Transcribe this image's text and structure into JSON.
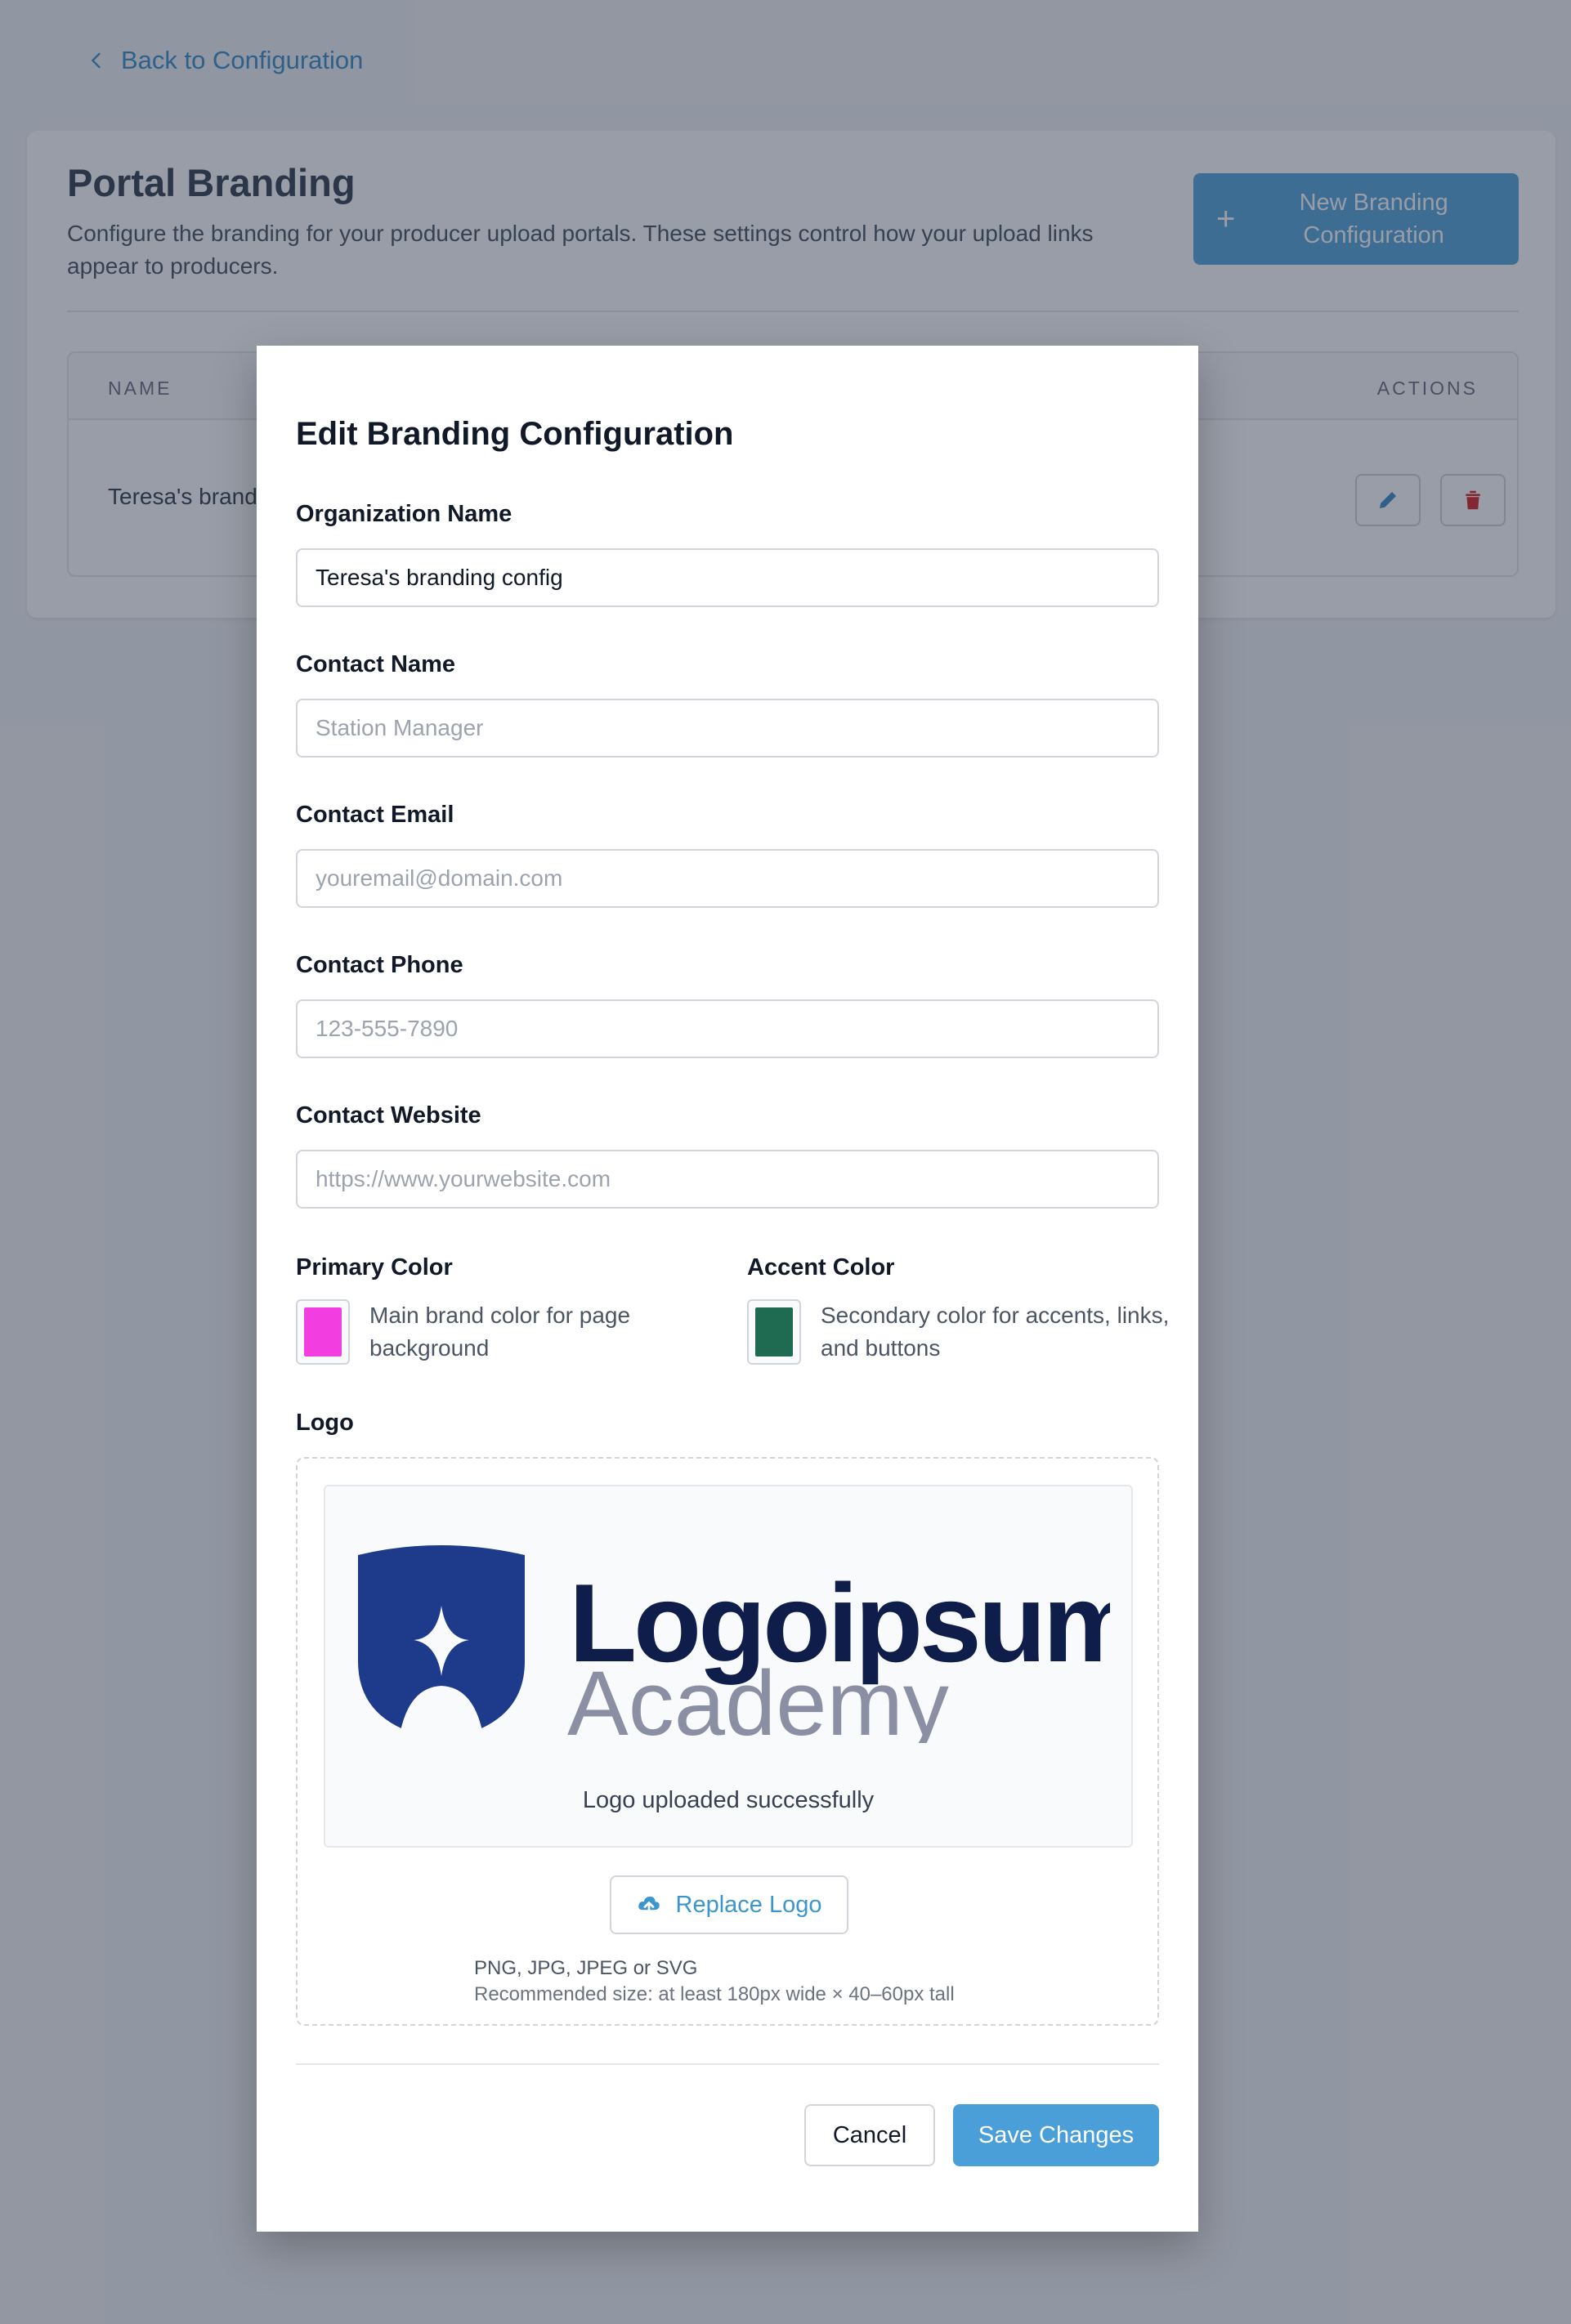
{
  "background": {
    "back_link": "Back to Configuration",
    "title": "Portal Branding",
    "description": "Configure the branding for your producer upload portals. These settings control how your upload links appear to producers.",
    "new_button": "New Branding Configuration",
    "table": {
      "headers": {
        "name": "NAME",
        "actions": "ACTIONS"
      },
      "rows": [
        {
          "name": "Teresa's branding config"
        }
      ]
    }
  },
  "modal": {
    "title": "Edit Branding Configuration",
    "fields": {
      "org_name": {
        "label": "Organization Name",
        "value": "Teresa's branding config",
        "placeholder": ""
      },
      "contact_name": {
        "label": "Contact Name",
        "value": "",
        "placeholder": "Station Manager"
      },
      "contact_email": {
        "label": "Contact Email",
        "value": "",
        "placeholder": "youremail@domain.com"
      },
      "contact_phone": {
        "label": "Contact Phone",
        "value": "",
        "placeholder": "123-555-7890"
      },
      "contact_website": {
        "label": "Contact Website",
        "value": "",
        "placeholder": "https://www.yourwebsite.com"
      }
    },
    "primary_color": {
      "label": "Primary Color",
      "value": "#f23ee0",
      "description": "Main brand color for page background"
    },
    "accent_color": {
      "label": "Accent Color",
      "value": "#1f6b52",
      "description": "Secondary color for accents, links, and buttons"
    },
    "logo": {
      "label": "Logo",
      "wordmark": "Logoipsum",
      "subtitle": "Academy",
      "status": "Logo uploaded successfully",
      "replace_button": "Replace Logo",
      "hint_formats": "PNG, JPG, JPEG or SVG",
      "hint_size": "Recommended size: at least 180px wide × 40–60px tall"
    },
    "cancel_button": "Cancel",
    "save_button": "Save Changes"
  },
  "colors": {
    "accent_blue": "#4a9fd8",
    "logo_navy": "#1e3a8a",
    "logo_text": "#0f1d4a",
    "logo_gray": "#8b8fa3"
  }
}
